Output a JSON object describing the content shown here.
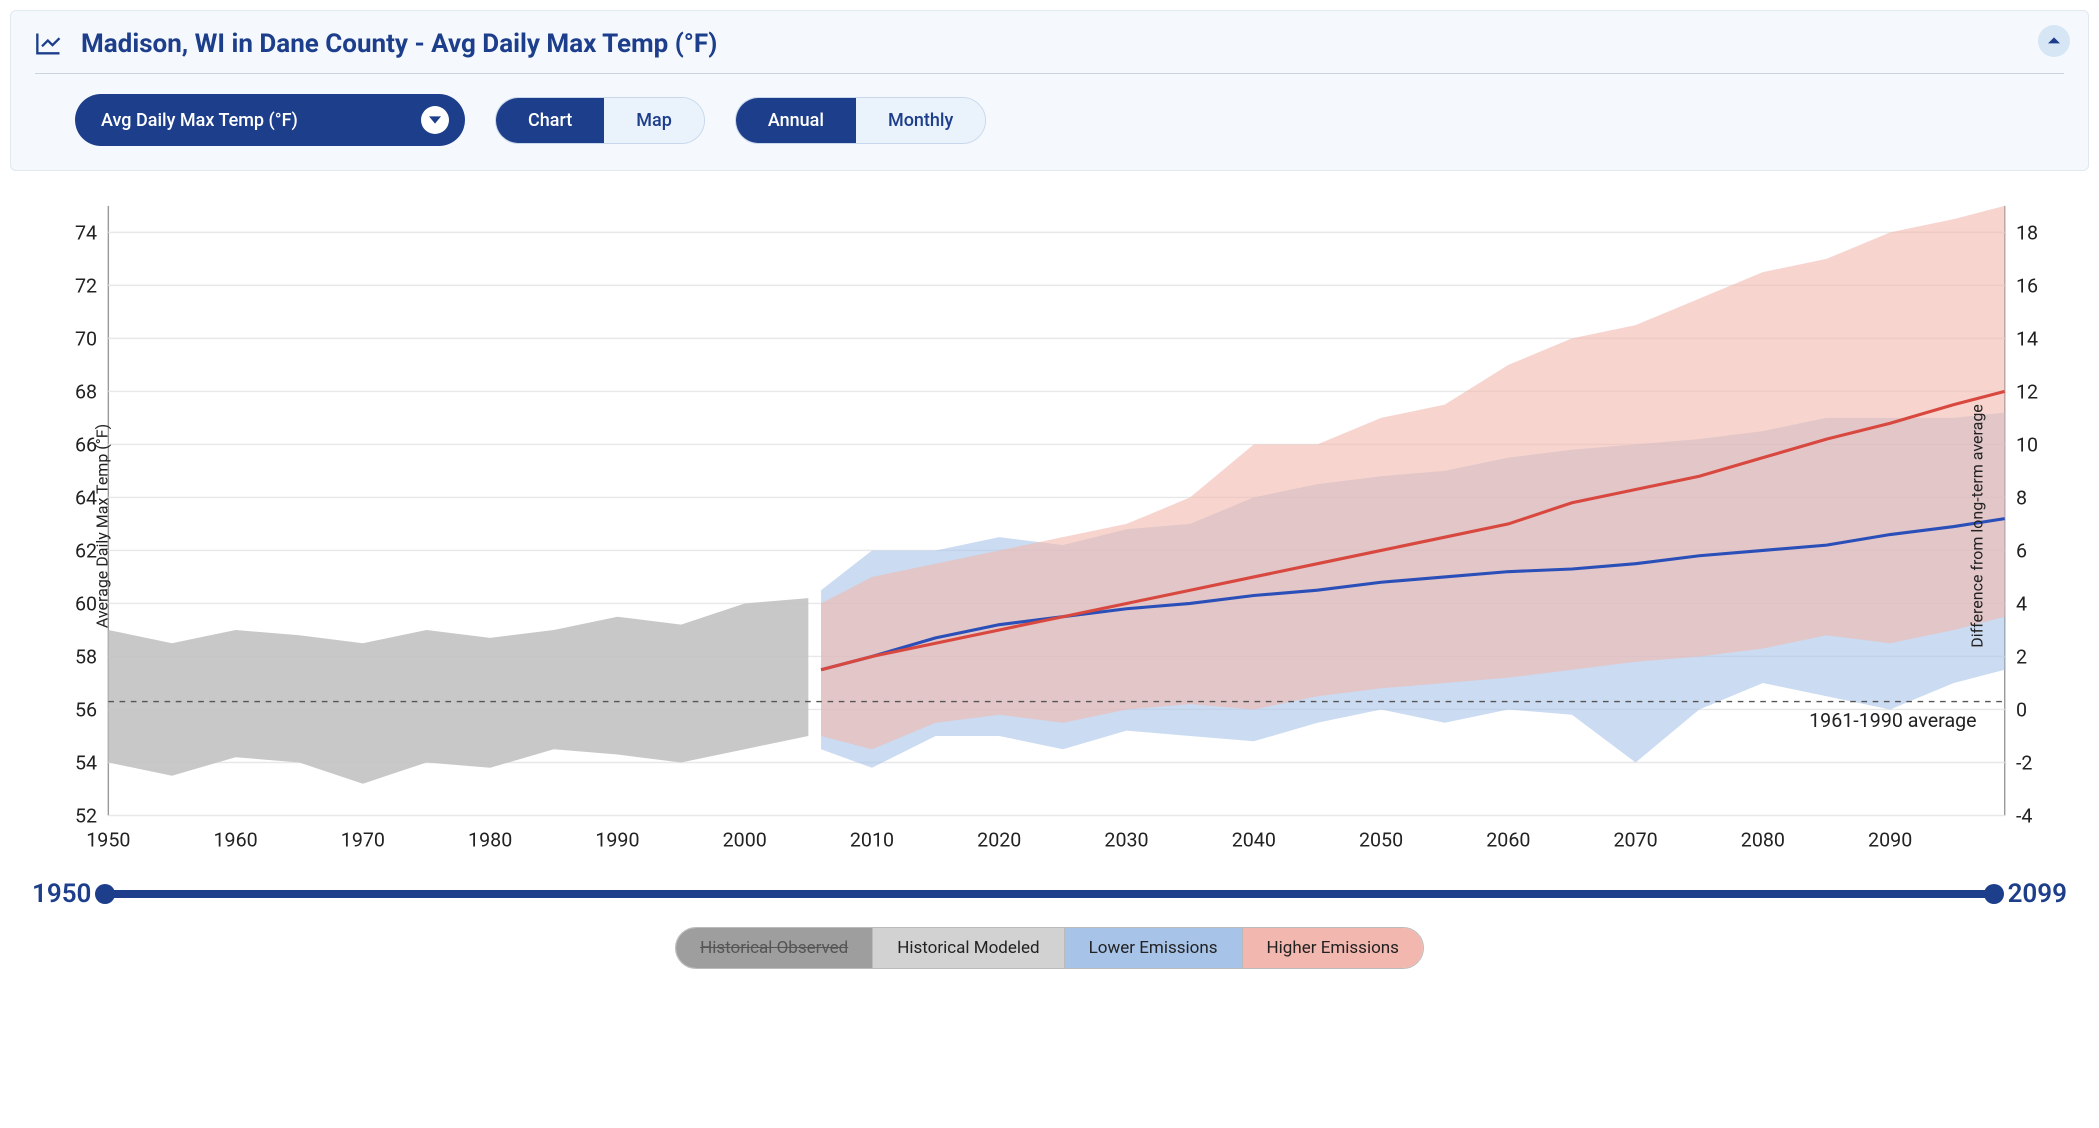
{
  "header": {
    "title": "Madison, WI in Dane County - Avg Daily Max Temp (°F)"
  },
  "controls": {
    "variable_dropdown": {
      "selected_label": "Avg Daily Max Temp (°F)"
    },
    "view_toggle": {
      "options": [
        "Chart",
        "Map"
      ],
      "selected": "Chart"
    },
    "period_toggle": {
      "options": [
        "Annual",
        "Monthly"
      ],
      "selected": "Annual"
    }
  },
  "slider": {
    "min_label": "1950",
    "max_label": "2099"
  },
  "legend": {
    "items": [
      {
        "key": "obs",
        "label": "Historical Observed",
        "strike": true
      },
      {
        "key": "mod",
        "label": "Historical Modeled",
        "strike": false
      },
      {
        "key": "low",
        "label": "Lower Emissions",
        "strike": false
      },
      {
        "key": "high",
        "label": "Higher Emissions",
        "strike": false
      }
    ]
  },
  "axes": {
    "y_left_label": "Average Daily Max Temp (°F)",
    "y_right_label": "Difference from long-term average",
    "baseline_label": "1961-1990 average"
  },
  "colors": {
    "primary": "#1d3e8b",
    "hist_modeled_fill": "#c2c2c2",
    "lower_fill": "#a8c3e8",
    "lower_line": "#2a4fb8",
    "higher_fill": "#f2b7ae",
    "higher_line": "#d8483f"
  },
  "chart_data": {
    "type": "line",
    "x_range": [
      1950,
      2099
    ],
    "x_ticks": [
      1950,
      1960,
      1970,
      1980,
      1990,
      2000,
      2010,
      2020,
      2030,
      2040,
      2050,
      2060,
      2070,
      2080,
      2090
    ],
    "y_left_range": [
      52,
      75
    ],
    "y_left_ticks": [
      52,
      54,
      56,
      58,
      60,
      62,
      64,
      66,
      68,
      70,
      72,
      74
    ],
    "y_right_range": [
      -4,
      19
    ],
    "y_right_ticks": [
      -4,
      -2,
      0,
      2,
      4,
      6,
      8,
      10,
      12,
      14,
      16,
      18
    ],
    "baseline_left_value": 56.3,
    "baseline_right_value": 0,
    "series": [
      {
        "name": "Historical Modeled",
        "kind": "band",
        "color": "#c2c2c2",
        "x": [
          1950,
          1955,
          1960,
          1965,
          1970,
          1975,
          1980,
          1985,
          1990,
          1995,
          2000,
          2005
        ],
        "low": [
          54.0,
          53.5,
          54.2,
          54.0,
          53.2,
          54.0,
          53.8,
          54.5,
          54.3,
          54.0,
          54.5,
          55.0
        ],
        "high": [
          59.0,
          58.5,
          59.0,
          58.8,
          58.5,
          59.0,
          58.7,
          59.0,
          59.5,
          59.2,
          60.0,
          60.2
        ]
      },
      {
        "name": "Lower Emissions",
        "kind": "band-line",
        "fill": "#a8c3e8",
        "stroke": "#2a4fb8",
        "x": [
          2006,
          2010,
          2015,
          2020,
          2025,
          2030,
          2035,
          2040,
          2045,
          2050,
          2055,
          2060,
          2065,
          2070,
          2075,
          2080,
          2085,
          2090,
          2095,
          2099
        ],
        "low": [
          54.5,
          53.8,
          55.0,
          55.0,
          54.5,
          55.2,
          55.0,
          54.8,
          55.5,
          56.0,
          55.5,
          56.0,
          55.8,
          54.0,
          56.0,
          57.0,
          56.5,
          56.0,
          57.0,
          57.5
        ],
        "mean": [
          57.5,
          58.0,
          58.7,
          59.2,
          59.5,
          59.8,
          60.0,
          60.3,
          60.5,
          60.8,
          61.0,
          61.2,
          61.3,
          61.5,
          61.8,
          62.0,
          62.2,
          62.6,
          62.9,
          63.2
        ],
        "high": [
          60.5,
          62.0,
          62.0,
          62.5,
          62.2,
          62.8,
          63.0,
          64.0,
          64.5,
          64.8,
          65.0,
          65.5,
          65.8,
          66.0,
          66.2,
          66.5,
          67.0,
          67.0,
          67.0,
          67.2
        ]
      },
      {
        "name": "Higher Emissions",
        "kind": "band-line",
        "fill": "#f2b7ae",
        "stroke": "#d8483f",
        "x": [
          2006,
          2010,
          2015,
          2020,
          2025,
          2030,
          2035,
          2040,
          2045,
          2050,
          2055,
          2060,
          2065,
          2070,
          2075,
          2080,
          2085,
          2090,
          2095,
          2099
        ],
        "low": [
          55.0,
          54.5,
          55.5,
          55.8,
          55.5,
          56.0,
          56.2,
          56.0,
          56.5,
          56.8,
          57.0,
          57.2,
          57.5,
          57.8,
          58.0,
          58.3,
          58.8,
          58.5,
          59.0,
          59.5
        ],
        "mean": [
          57.5,
          58.0,
          58.5,
          59.0,
          59.5,
          60.0,
          60.5,
          61.0,
          61.5,
          62.0,
          62.5,
          63.0,
          63.8,
          64.3,
          64.8,
          65.5,
          66.2,
          66.8,
          67.5,
          68.0
        ],
        "high": [
          60.0,
          61.0,
          61.5,
          62.0,
          62.5,
          63.0,
          64.0,
          66.0,
          66.0,
          67.0,
          67.5,
          69.0,
          70.0,
          70.5,
          71.5,
          72.5,
          73.0,
          74.0,
          74.5,
          75.0
        ]
      }
    ]
  }
}
